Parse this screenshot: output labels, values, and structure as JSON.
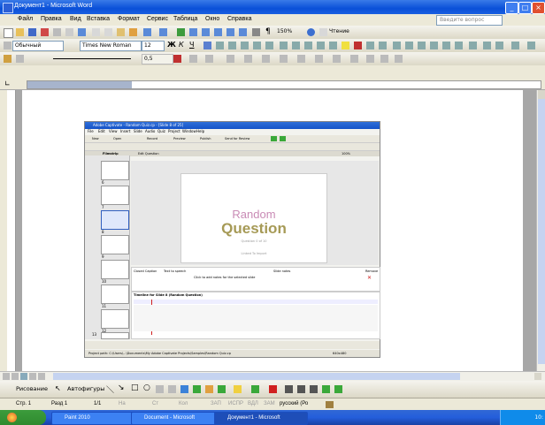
{
  "window": {
    "title": "Документ1 - Microsoft Word"
  },
  "menu": {
    "items": [
      "Файл",
      "Правка",
      "Вид",
      "Вставка",
      "Формат",
      "Сервис",
      "Таблица",
      "Окно",
      "Справка"
    ],
    "help_placeholder": "Введите вопрос"
  },
  "toolbar_standard": {
    "zoom": "150%",
    "reading_label": "Чтение"
  },
  "toolbar_format": {
    "style": "Обычный",
    "font": "Times New Roman",
    "size": "12"
  },
  "toolbar_extra": {
    "line_width": "0,5"
  },
  "screenshot": {
    "title": "Adobe Captivate - Random Quiz.cp - [Slide 8 of 25]",
    "menu": [
      "File",
      "Edit",
      "View",
      "Insert",
      "Slide",
      "Audio",
      "Quiz",
      "Project",
      "Window",
      "Help"
    ],
    "toolbar": [
      "New",
      "Open",
      "Record",
      "Preview",
      "Publish",
      "Send for Review"
    ],
    "tab_filmstrip": "Filmstrip",
    "tab_edit": "Edit Question",
    "zoom": "100%",
    "slide_numbers": [
      "6",
      "7",
      "8",
      "9",
      "10",
      "11",
      "12",
      "13"
    ],
    "slide": {
      "line1": "Random",
      "line2": "Question",
      "line3": "Question 0 of 10",
      "line4": "Linked To Import"
    },
    "notes": {
      "label1": "Closed Caption",
      "label2": "Text to speech",
      "label3": "Slide notes",
      "hint": "Click to add notes for the selected slide",
      "remove": "Remove"
    },
    "timeline": {
      "title": "Timeline for Slide 8 (Random Question)"
    },
    "status": "Project path: C:\\Users\\...\\Documents\\My Adobe Captivate Projects\\Samples\\Random Quiz.cp",
    "dims": "640x480"
  },
  "draw_toolbar": {
    "drawing": "Рисование",
    "autoshapes": "Автофигуры"
  },
  "status": {
    "page": "Стр. 1",
    "section": "Разд 1",
    "of": "1/1",
    "at": "На",
    "line": "Ст",
    "col": "Кол",
    "rec": "ЗАП",
    "trk": "ИСПР",
    "ext": "ВДЛ",
    "ovr": "ЗАМ",
    "lang": "русский (Ро"
  },
  "taskbar": {
    "tasks": [
      "Paint 2010",
      "Document - Microsoft",
      "Документ1 - Microsoft"
    ],
    "clock": "10:"
  }
}
